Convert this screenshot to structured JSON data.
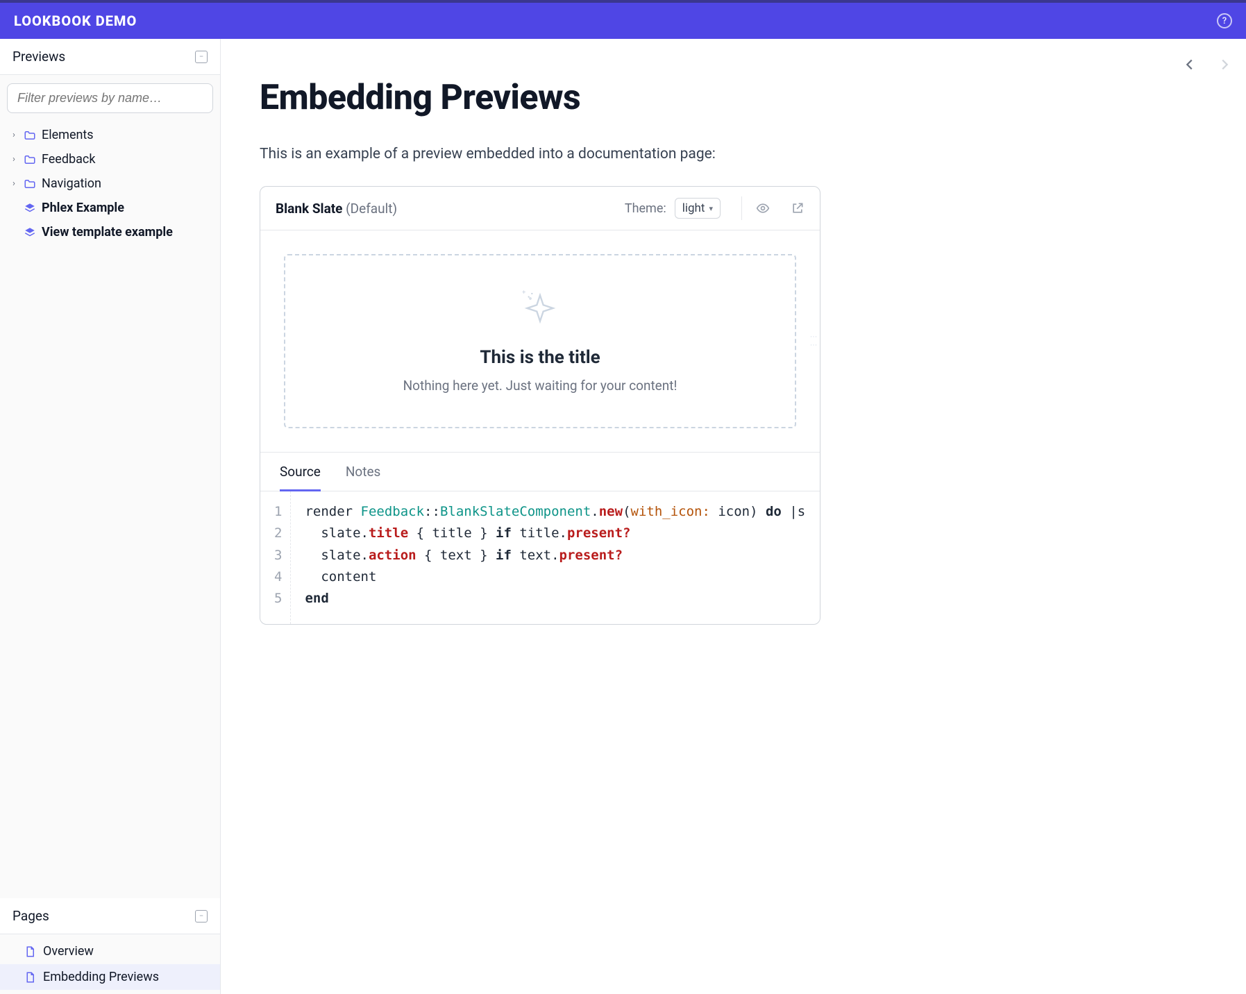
{
  "brand": "LOOKBOOK DEMO",
  "sidebar": {
    "previews_label": "Previews",
    "filter_placeholder": "Filter previews by name…",
    "tree": [
      {
        "label": "Elements"
      },
      {
        "label": "Feedback"
      },
      {
        "label": "Navigation"
      },
      {
        "label": "Phlex Example"
      },
      {
        "label": "View template example"
      }
    ],
    "pages_label": "Pages",
    "pages": [
      {
        "label": "Overview"
      },
      {
        "label": "Embedding Previews"
      }
    ]
  },
  "page": {
    "title": "Embedding Previews",
    "intro": "This is an example of a preview embedded into a documentation page:"
  },
  "embed": {
    "name": "Blank Slate",
    "variant": "(Default)",
    "theme_label": "Theme:",
    "theme_value": "light",
    "slate_title": "This is the title",
    "slate_sub": "Nothing here yet. Just waiting for your content!",
    "tabs": {
      "source": "Source",
      "notes": "Notes"
    }
  },
  "code": {
    "line_count": 5,
    "l1": {
      "a": "render ",
      "b": "Feedback",
      "c": "::",
      "d": "BlankSlateComponent",
      "e": ".",
      "f": "new",
      "g": "(",
      "h": "with_icon:",
      "i": " icon) ",
      "j": "do",
      "k": " |s"
    },
    "l2": {
      "a": "  slate.",
      "b": "title",
      "c": " { title } ",
      "d": "if",
      "e": " title.",
      "f": "present?"
    },
    "l3": {
      "a": "  slate.",
      "b": "action",
      "c": " { text } ",
      "d": "if",
      "e": " text.",
      "f": "present?"
    },
    "l4": "  content",
    "l5": "end"
  }
}
